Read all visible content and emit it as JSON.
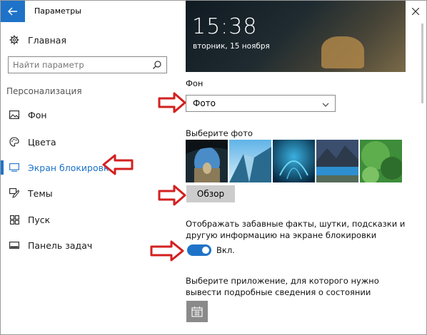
{
  "window": {
    "title": "Параметры",
    "controls": [
      "minimize",
      "maximize",
      "close"
    ]
  },
  "sidebar": {
    "home_label": "Главная",
    "search": {
      "placeholder": "Найти параметр",
      "value": ""
    },
    "section_label": "Персонализация",
    "items": [
      {
        "label": "Фон",
        "icon": "picture-icon",
        "active": false
      },
      {
        "label": "Цвета",
        "icon": "palette-icon",
        "active": false
      },
      {
        "label": "Экран блокировки",
        "icon": "monitor-icon",
        "active": true
      },
      {
        "label": "Темы",
        "icon": "brush-icon",
        "active": false
      },
      {
        "label": "Пуск",
        "icon": "start-grid-icon",
        "active": false
      },
      {
        "label": "Панель задач",
        "icon": "taskbar-icon",
        "active": false
      }
    ]
  },
  "main": {
    "preview": {
      "time": "15:38",
      "date": "вторник, 15 ноября"
    },
    "background": {
      "label": "Фон",
      "selected": "Фото"
    },
    "photos": {
      "label": "Выберите фото",
      "count": 5
    },
    "browse_button": "Обзор",
    "fun_facts": {
      "description": "Отображать забавные факты, шутки, подсказки и другую информацию на экране блокировки",
      "toggle_state": "on",
      "toggle_label": "Вкл."
    },
    "app_status": {
      "description": "Выберите приложение, для которого нужно вывести подробные сведения о состоянии",
      "icon": "calendar-icon"
    }
  },
  "colors": {
    "accent": "#1e73c8",
    "annotation_arrow": "#d32020"
  }
}
